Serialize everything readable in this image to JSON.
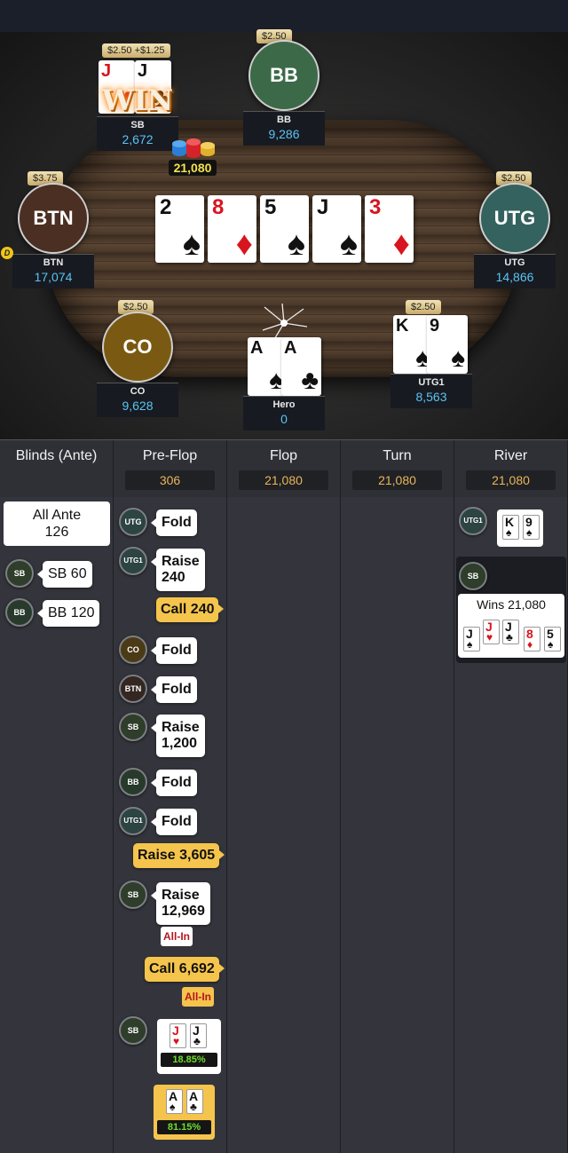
{
  "colors": {
    "accent_gold": "#f5c44c",
    "stack_blue": "#5ac4f5",
    "pot_yellow": "#f3e24b",
    "equity_green": "#6fdd2d",
    "allin_red": "#b5161e"
  },
  "table": {
    "pot": "21,080",
    "win_text": "WIN",
    "board": [
      {
        "rank": "2",
        "suit": "♠",
        "color": "black"
      },
      {
        "rank": "8",
        "suit": "♦",
        "color": "red"
      },
      {
        "rank": "5",
        "suit": "♠",
        "color": "black"
      },
      {
        "rank": "J",
        "suit": "♠",
        "color": "black"
      },
      {
        "rank": "3",
        "suit": "♦",
        "color": "red"
      }
    ],
    "dealer_button": "D",
    "seats": {
      "sb": {
        "name": "SB",
        "stack": "2,672",
        "bet": "$2.50",
        "bet_extra": "+$1.25",
        "cards": [
          {
            "rank": "J",
            "suit": "♥",
            "color": "red"
          },
          {
            "rank": "J",
            "suit": "♣",
            "color": "black"
          }
        ]
      },
      "bb": {
        "name": "BB",
        "avatar": "BB",
        "stack": "9,286",
        "bet": "$2.50",
        "color": "#3c6a48"
      },
      "btn": {
        "name": "BTN",
        "avatar": "BTN",
        "stack": "17,074",
        "bet": "$3.75",
        "color": "#4b2f22"
      },
      "utg": {
        "name": "UTG",
        "avatar": "UTG",
        "stack": "14,866",
        "bet": "$2.50",
        "color": "#34625e"
      },
      "co": {
        "name": "CO",
        "avatar": "CO",
        "stack": "9,628",
        "bet": "$2.50",
        "color": "#7a5a12"
      },
      "hero": {
        "name": "Hero",
        "stack": "0",
        "cards": [
          {
            "rank": "A",
            "suit": "♠",
            "color": "black"
          },
          {
            "rank": "A",
            "suit": "♣",
            "color": "black"
          }
        ]
      },
      "utg1": {
        "name": "UTG1",
        "stack": "8,563",
        "bet": "$2.50",
        "cards": [
          {
            "rank": "K",
            "suit": "♠",
            "color": "black"
          },
          {
            "rank": "9",
            "suit": "♠",
            "color": "black"
          }
        ]
      }
    }
  },
  "history": {
    "columns": [
      {
        "title": "Blinds (Ante)",
        "value": ""
      },
      {
        "title": "Pre-Flop",
        "value": "306"
      },
      {
        "title": "Flop",
        "value": "21,080"
      },
      {
        "title": "Turn",
        "value": "21,080"
      },
      {
        "title": "River",
        "value": "21,080"
      }
    ],
    "blinds": {
      "ante_line1": "All Ante",
      "ante_line2": "126",
      "items": [
        {
          "pos": "SB",
          "action": "SB 60"
        },
        {
          "pos": "BB",
          "action": "BB 120"
        }
      ]
    },
    "preflop": [
      {
        "pos": "UTG",
        "line1": "Fold",
        "line2": ""
      },
      {
        "pos": "UTG1",
        "line1": "Raise",
        "line2": "240"
      },
      {
        "hero_action": "Call 240"
      },
      {
        "pos": "CO",
        "line1": "Fold",
        "line2": ""
      },
      {
        "pos": "BTN",
        "line1": "Fold",
        "line2": ""
      },
      {
        "pos": "SB",
        "line1": "Raise",
        "line2": "1,200"
      },
      {
        "pos": "BB",
        "line1": "Fold",
        "line2": ""
      },
      {
        "pos": "UTG1",
        "line1": "Fold",
        "line2": ""
      },
      {
        "hero_action": "Raise 3,605"
      },
      {
        "pos": "SB",
        "line1": "Raise",
        "line2": "12,969"
      },
      {
        "allin": "All-In"
      },
      {
        "hero_action": "Call 6,692"
      },
      {
        "hero_allin": "All-In"
      }
    ],
    "showdown": {
      "sb_pos": "SB",
      "sb_cards": [
        {
          "rank": "J",
          "suit": "♥",
          "color": "red"
        },
        {
          "rank": "J",
          "suit": "♣",
          "color": "black"
        }
      ],
      "sb_equity": "18.85%",
      "hero_cards": [
        {
          "rank": "A",
          "suit": "♠",
          "color": "black"
        },
        {
          "rank": "A",
          "suit": "♣",
          "color": "black"
        }
      ],
      "hero_equity": "81.15%"
    },
    "river": {
      "utg1_pos": "UTG1",
      "utg1_cards": [
        {
          "rank": "K",
          "suit": "♠",
          "color": "black"
        },
        {
          "rank": "9",
          "suit": "♠",
          "color": "black"
        }
      ],
      "winner_pos": "SB",
      "wins_text": "Wins 21,080",
      "win_cards": [
        {
          "rank": "J",
          "suit": "♠",
          "color": "black"
        },
        {
          "rank": "J",
          "suit": "♥",
          "color": "red"
        },
        {
          "rank": "J",
          "suit": "♣",
          "color": "black"
        },
        {
          "rank": "8",
          "suit": "♦",
          "color": "red"
        },
        {
          "rank": "5",
          "suit": "♠",
          "color": "black"
        }
      ]
    }
  }
}
